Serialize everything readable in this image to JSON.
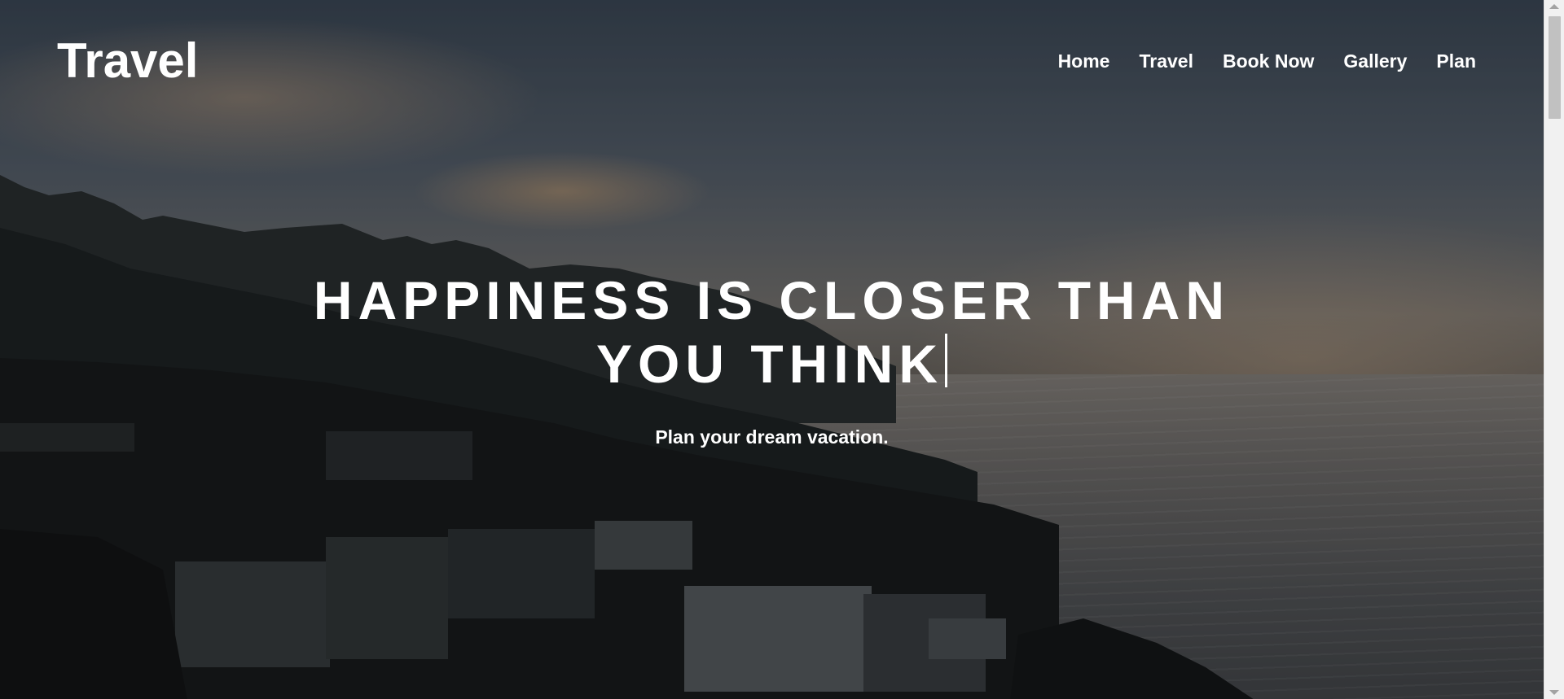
{
  "brand": {
    "logo_text": "Travel"
  },
  "nav": {
    "items": [
      {
        "label": "Home"
      },
      {
        "label": "Travel"
      },
      {
        "label": "Book Now"
      },
      {
        "label": "Gallery"
      },
      {
        "label": "Plan"
      }
    ]
  },
  "hero": {
    "headline_line1": "HAPPINESS IS CLOSER THAN",
    "headline_line2": "YOU THINK",
    "subtitle": "Plan your dream vacation."
  },
  "colors": {
    "text": "#ffffff"
  }
}
